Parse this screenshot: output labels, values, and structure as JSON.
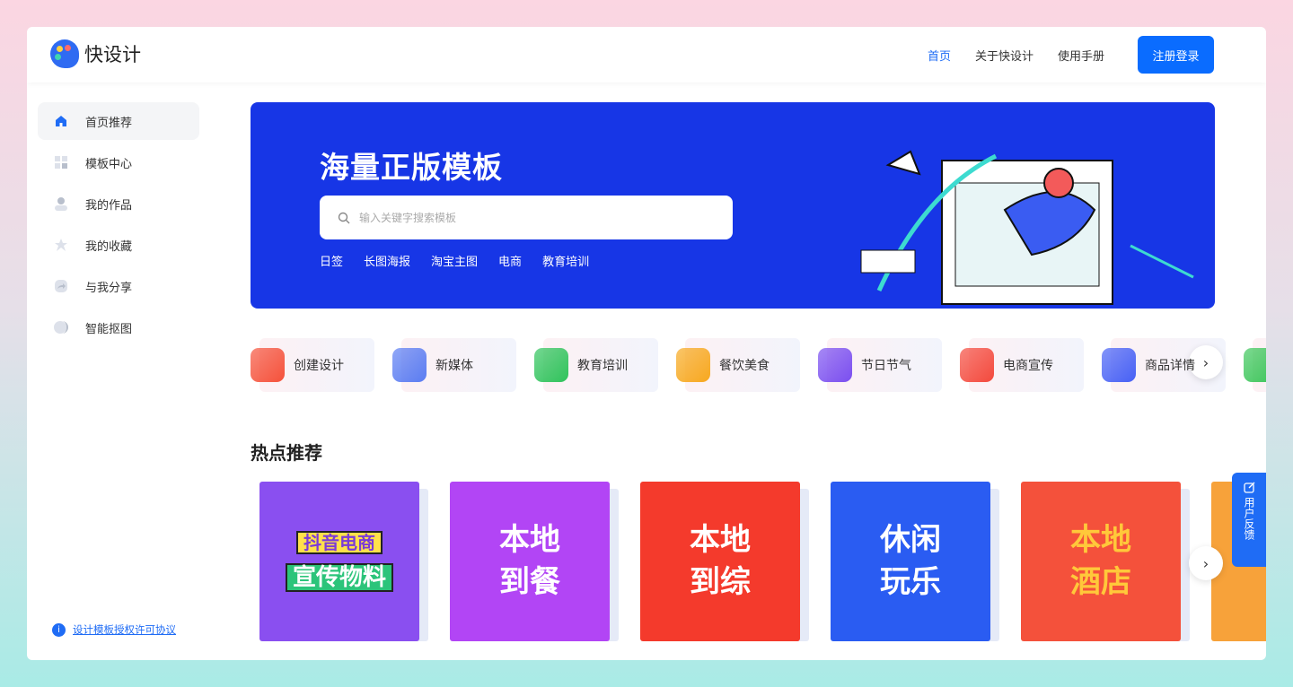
{
  "app": {
    "name": "快设计"
  },
  "nav": {
    "items": [
      "首页",
      "关于快设计",
      "使用手册"
    ],
    "active": 0,
    "login": "注册登录"
  },
  "sidebar": {
    "items": [
      {
        "label": "首页推荐",
        "icon": "home-icon"
      },
      {
        "label": "模板中心",
        "icon": "grid-icon"
      },
      {
        "label": "我的作品",
        "icon": "user-icon"
      },
      {
        "label": "我的收藏",
        "icon": "star-icon"
      },
      {
        "label": "与我分享",
        "icon": "share-icon"
      },
      {
        "label": "智能抠图",
        "icon": "cutout-icon"
      }
    ],
    "active": 0,
    "license": "设计模板授权许可协议"
  },
  "banner": {
    "title": "海量正版模板",
    "search_placeholder": "输入关键字搜索模板",
    "tags": [
      "日签",
      "长图海报",
      "淘宝主图",
      "电商",
      "教育培训"
    ]
  },
  "categories": [
    {
      "label": "创建设计",
      "color": "#f5513a"
    },
    {
      "label": "新媒体",
      "color": "#5a7cf2"
    },
    {
      "label": "教育培训",
      "color": "#2fc35b"
    },
    {
      "label": "餐饮美食",
      "color": "#f7a81e"
    },
    {
      "label": "节日节气",
      "color": "#7a4ef0"
    },
    {
      "label": "电商宣传",
      "color": "#f4493c"
    },
    {
      "label": "商品详情",
      "color": "#4660f5"
    },
    {
      "label": "",
      "color": "#3cc65a"
    }
  ],
  "hot": {
    "title": "热点推荐",
    "cards": [
      {
        "l1": "抖音电商",
        "l2": "宣传物料",
        "bg": "#8a4ff0",
        "fg": "#ffe14a"
      },
      {
        "l1": "本地",
        "l2": "到餐",
        "bg": "#b245f5",
        "fg": "#fff"
      },
      {
        "l1": "本地",
        "l2": "到综",
        "bg": "#f43a2c",
        "fg": "#fff"
      },
      {
        "l1": "休闲",
        "l2": "玩乐",
        "bg": "#2a5cf2",
        "fg": "#fff"
      },
      {
        "l1": "本地",
        "l2": "酒店",
        "bg": "#f4513b",
        "fg": "#ffc83a"
      }
    ]
  },
  "feedback": "用户反馈",
  "colors": {
    "accent": "#1f6cf5",
    "banner": "#1736e6"
  }
}
